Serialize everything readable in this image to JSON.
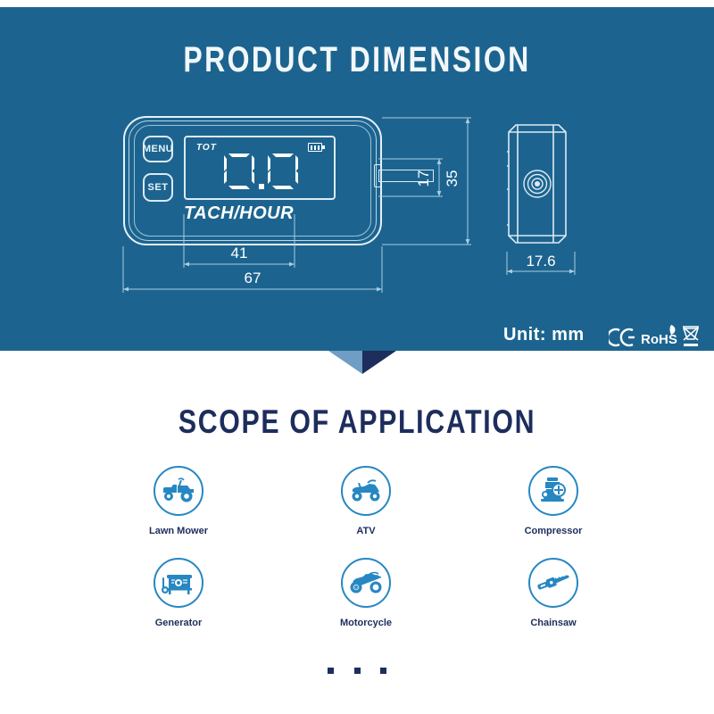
{
  "theme": {
    "panel_blue": "#1c648f",
    "navy": "#1d2d5c",
    "icon_blue": "#2787c3",
    "chevron_light": "#6f9dc4",
    "chevron_dark": "#1d2d5c",
    "blueprint_line": "#dceaf3"
  },
  "dimension_section": {
    "title": "PRODUCT DIMENSION",
    "unit_label": "Unit: mm",
    "device": {
      "button_menu": "MENU",
      "button_set": "SET",
      "lcd_mode_label": "TOT",
      "lcd_reading": "0.0",
      "brand_text": "TACH/HOUR",
      "battery_icon": "battery-icon"
    },
    "measurements": {
      "overall_width": "67",
      "screen_width": "41",
      "overall_height": "35",
      "inner_height": "17",
      "depth": "17.6"
    },
    "certifications": [
      {
        "name": "ce-mark",
        "label": "CE"
      },
      {
        "name": "rohs-mark",
        "label": "RoHS"
      },
      {
        "name": "weee-bin-mark",
        "label": ""
      }
    ]
  },
  "scope_section": {
    "title": "SCOPE OF APPLICATION",
    "applications": [
      {
        "label": "Lawn Mower",
        "icon": "lawn-mower-icon"
      },
      {
        "label": "ATV",
        "icon": "atv-icon"
      },
      {
        "label": "Compressor",
        "icon": "compressor-icon"
      },
      {
        "label": "Generator",
        "icon": "generator-icon"
      },
      {
        "label": "Motorcycle",
        "icon": "motorcycle-icon"
      },
      {
        "label": "Chainsaw",
        "icon": "chainsaw-icon"
      }
    ],
    "more_indicator": "..."
  }
}
